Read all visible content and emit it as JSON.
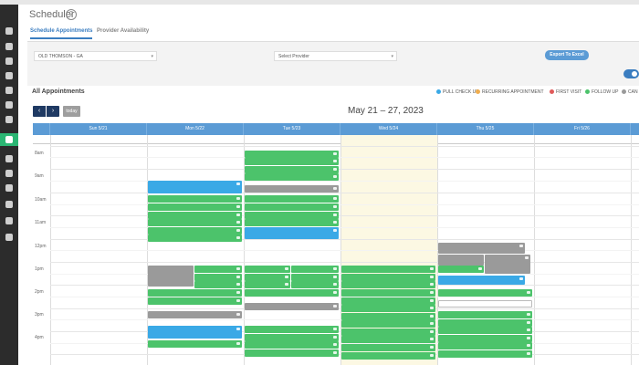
{
  "app": {
    "title": "Scheduler",
    "help_glyph": "?"
  },
  "tabs": [
    {
      "label": "Schedule Appointments",
      "active": true
    },
    {
      "label": "Provider Availability",
      "active": false
    }
  ],
  "filters": {
    "location": "OLD THOMSON - GA",
    "provider": "Select Provider",
    "export_label": "Export To Excel"
  },
  "calendar": {
    "heading": "All Appointments",
    "prev": "‹",
    "next": "›",
    "today_label": "today",
    "range": "May 21 – 27, 2023",
    "days": [
      "Sun 5/21",
      "Mon 5/22",
      "Tue 5/23",
      "Wed 5/24",
      "Thu 5/25",
      "Fri 5/26"
    ],
    "hours": [
      "8am",
      "9am",
      "10am",
      "11am",
      "12pm",
      "1pm",
      "2pm",
      "3pm",
      "4pm"
    ]
  },
  "legend": [
    {
      "label": "PULL CHECK UP",
      "color": "#3aa9e6"
    },
    {
      "label": "RECURRING APPOINTMENT",
      "color": "#f0ad4e"
    },
    {
      "label": "FIRST VISIT",
      "color": "#e05a5a"
    },
    {
      "label": "FOLLOW UP",
      "color": "#4cc36b"
    },
    {
      "label": "CAN",
      "color": "#9a9a9a"
    }
  ],
  "colors": {
    "sidebar": "#2c2c2c",
    "accent_green": "#2bb673",
    "header_blue": "#5b9bd5",
    "nav_dark": "#1f3a63",
    "today_bg": "#fcf8e3",
    "appt_green": "#4cc36b",
    "appt_gray": "#9a9a9a",
    "appt_blue": "#3aa9e6"
  },
  "sidebar_icons": [
    "home-icon",
    "calendar-icon",
    "bell-icon",
    "user-icon",
    "gear-icon",
    "flag-icon",
    "upload-icon",
    "edit-icon",
    "chart-icon",
    "users-icon",
    "dollar-icon",
    "list-icon",
    "tag-icon",
    "file-icon",
    "document-icon"
  ]
}
